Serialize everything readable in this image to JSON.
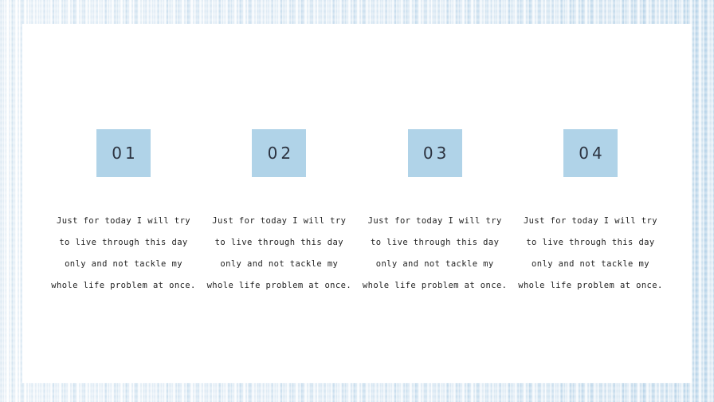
{
  "slide": {
    "background_color": "#e6f0f8",
    "card_color": "#ffffff",
    "accent_color": "#b0d3e8",
    "text_color": "#1f1f1f",
    "number_color": "#2c3340"
  },
  "columns": [
    {
      "number": "01",
      "body": "Just for today I will try\nto live through this day\nonly and not tackle my\nwhole life problem at once."
    },
    {
      "number": "02",
      "body": "Just for today I will try\nto live through this day\nonly and not tackle my\nwhole life problem at once."
    },
    {
      "number": "03",
      "body": "Just for today I will try\nto live through this day\nonly and not tackle my\nwhole life problem at once."
    },
    {
      "number": "04",
      "body": "Just for today I will try\nto live through this day\nonly and not tackle my\nwhole life problem at once."
    }
  ]
}
